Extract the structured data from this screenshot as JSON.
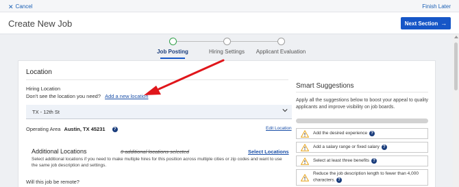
{
  "topbar": {
    "cancel_label": "Cancel",
    "finish_later_label": "Finish Later"
  },
  "header": {
    "title": "Create New Job",
    "next_label": "Next Section"
  },
  "steps": [
    {
      "label": "Job Posting",
      "active": true
    },
    {
      "label": "Hiring Settings",
      "active": false
    },
    {
      "label": "Applicant Evaluation",
      "active": false
    }
  ],
  "location": {
    "section_title": "Location",
    "hiring_location_label": "Hiring Location",
    "missing_prompt": "Don't see the location you need?",
    "add_location_link": "Add a new location",
    "selected_location": "TX - 12th St",
    "operating_area_label": "Operating Area",
    "operating_area_value": "Austin, TX 45231",
    "edit_location_link": "Edit Location",
    "additional_title": "Additional Locations",
    "additional_count": "0 additional locations selected",
    "select_locations_link": "Select Locations",
    "additional_desc": "Select additional locations if you need to make multiple hires for this position across multiple cities or zip codes and want to use the same job description and settings.",
    "remote_question": "Will this job be remote?"
  },
  "smart": {
    "title": "Smart Suggestions",
    "description": "Apply all the suggestions below to boost your appeal to quality applicants and improve visibility on job boards.",
    "items": [
      "Add the desired experience",
      "Add a salary range or fixed salary",
      "Select at least three benefits",
      "Reduce the job description length to fewer than 4,000 characters."
    ]
  },
  "colors": {
    "primary": "#1656c7",
    "link": "#1a4fa8",
    "active_step": "#2e9e46",
    "annotation_arrow": "#e0161b",
    "warning": "#e8a317"
  }
}
